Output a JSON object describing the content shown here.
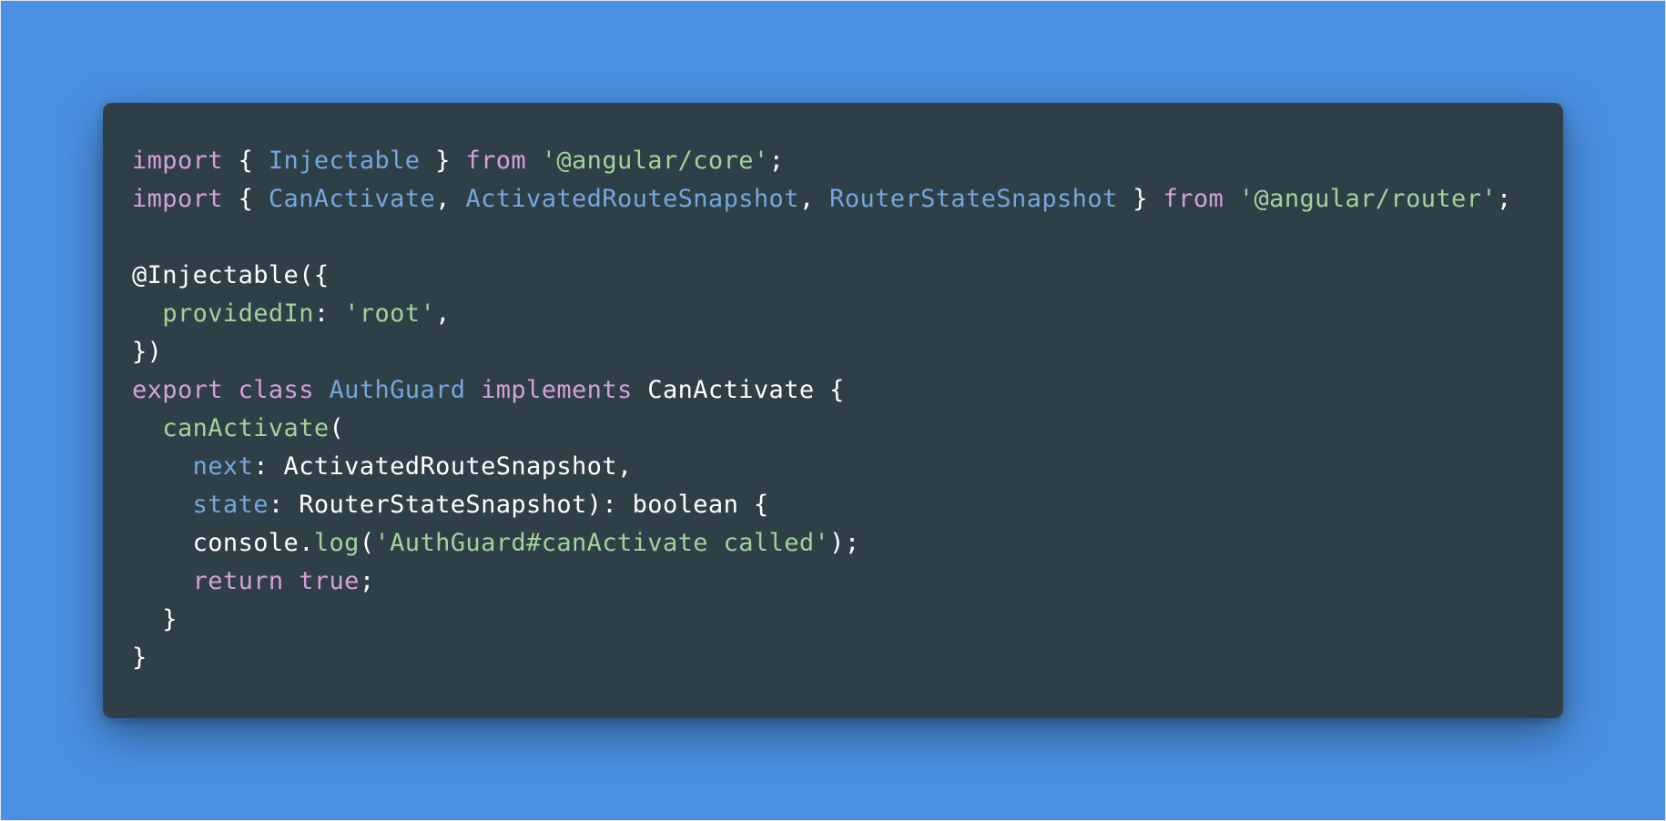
{
  "background_color": "#4a90e2",
  "editor_background_color": "#2f3f48",
  "syntax_colors": {
    "keyword": "#d4a0d6",
    "type": "#74a7dd",
    "string": "#a5d19a",
    "plain": "#ffffff"
  },
  "code_lines": [
    [
      {
        "text": "import",
        "kind": "keyword"
      },
      {
        "text": " { ",
        "kind": "plain"
      },
      {
        "text": "Injectable",
        "kind": "type"
      },
      {
        "text": " } ",
        "kind": "plain"
      },
      {
        "text": "from",
        "kind": "keyword"
      },
      {
        "text": " ",
        "kind": "plain"
      },
      {
        "text": "'@angular/core'",
        "kind": "string"
      },
      {
        "text": ";",
        "kind": "plain"
      }
    ],
    [
      {
        "text": "import",
        "kind": "keyword"
      },
      {
        "text": " { ",
        "kind": "plain"
      },
      {
        "text": "CanActivate",
        "kind": "type"
      },
      {
        "text": ", ",
        "kind": "plain"
      },
      {
        "text": "ActivatedRouteSnapshot",
        "kind": "type"
      },
      {
        "text": ", ",
        "kind": "plain"
      },
      {
        "text": "RouterStateSnapshot",
        "kind": "type"
      },
      {
        "text": " } ",
        "kind": "plain"
      },
      {
        "text": "from",
        "kind": "keyword"
      },
      {
        "text": " ",
        "kind": "plain"
      },
      {
        "text": "'@angular/router'",
        "kind": "string"
      },
      {
        "text": ";",
        "kind": "plain"
      }
    ],
    [],
    [
      {
        "text": "@Injectable({",
        "kind": "plain"
      }
    ],
    [
      {
        "text": "  ",
        "kind": "plain"
      },
      {
        "text": "providedIn",
        "kind": "string"
      },
      {
        "text": ": ",
        "kind": "plain"
      },
      {
        "text": "'root'",
        "kind": "string"
      },
      {
        "text": ",",
        "kind": "plain"
      }
    ],
    [
      {
        "text": "})",
        "kind": "plain"
      }
    ],
    [
      {
        "text": "export",
        "kind": "keyword"
      },
      {
        "text": " ",
        "kind": "plain"
      },
      {
        "text": "class",
        "kind": "keyword"
      },
      {
        "text": " ",
        "kind": "plain"
      },
      {
        "text": "AuthGuard",
        "kind": "type"
      },
      {
        "text": " ",
        "kind": "plain"
      },
      {
        "text": "implements",
        "kind": "keyword"
      },
      {
        "text": " CanActivate {",
        "kind": "plain"
      }
    ],
    [
      {
        "text": "  ",
        "kind": "plain"
      },
      {
        "text": "canActivate",
        "kind": "string"
      },
      {
        "text": "(",
        "kind": "plain"
      }
    ],
    [
      {
        "text": "    ",
        "kind": "plain"
      },
      {
        "text": "next",
        "kind": "type"
      },
      {
        "text": ": ActivatedRouteSnapshot,",
        "kind": "plain"
      }
    ],
    [
      {
        "text": "    ",
        "kind": "plain"
      },
      {
        "text": "state",
        "kind": "type"
      },
      {
        "text": ": RouterStateSnapshot): boolean {",
        "kind": "plain"
      }
    ],
    [
      {
        "text": "    console.",
        "kind": "plain"
      },
      {
        "text": "log",
        "kind": "string"
      },
      {
        "text": "(",
        "kind": "plain"
      },
      {
        "text": "'AuthGuard#canActivate called'",
        "kind": "string"
      },
      {
        "text": ");",
        "kind": "plain"
      }
    ],
    [
      {
        "text": "    ",
        "kind": "plain"
      },
      {
        "text": "return",
        "kind": "keyword"
      },
      {
        "text": " ",
        "kind": "plain"
      },
      {
        "text": "true",
        "kind": "keyword"
      },
      {
        "text": ";",
        "kind": "plain"
      }
    ],
    [
      {
        "text": "  }",
        "kind": "plain"
      }
    ],
    [
      {
        "text": "}",
        "kind": "plain"
      }
    ]
  ]
}
